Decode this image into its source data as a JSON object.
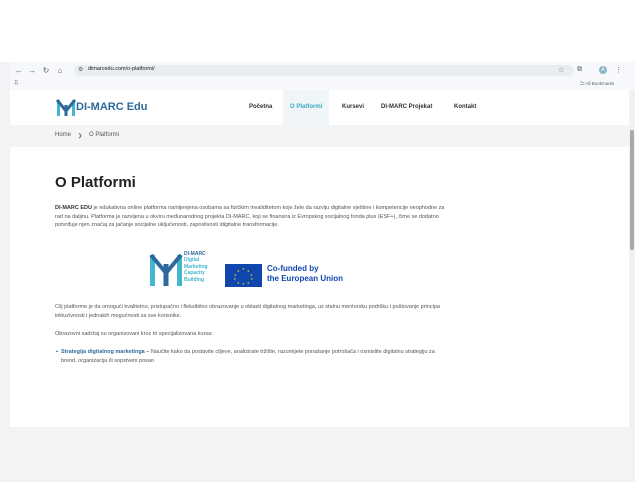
{
  "browser": {
    "url": "dimarcedu.com/o-platformi/",
    "bookmarks_label": "All Bookmarks",
    "avatar_letter": "A"
  },
  "site": {
    "logo_text": "DI-MARC Edu",
    "nav": [
      "Početna",
      "O Platformi",
      "Kursevi",
      "DI-MARC Projekat",
      "Kontakt"
    ],
    "breadcrumb": {
      "home": "Home",
      "separator": "❯",
      "current": "O Platformi"
    }
  },
  "content": {
    "title": "O Platformi",
    "intro_bold": "DI-MARC EDU",
    "intro_rest": " je edukativna online platforma namijenjena osobama sa fizičkim invaliditetom koje žele da razviju digitalne vještine i kompetencije neophodne za rad na daljinu. Platforma je razvijena u okviru međunarodnog projekta DI-MARC, koji se finansira iz Evropskog socijalnog fonda plus (ESF+), čime se dodatno potvrđuje njen značaj za jačanje socijalne uključenosti, zaposlivosti idigitalne transformacije.",
    "goal": "Cilj platforme je da omogući kvalitetno, pristupačno i fleksibilno obrazovanje u oblasti digitalnog marketinga, uz stalnu mentorsku podršku i poštovanje principa inkluzivnosti i jednakih mogućnosti za sve korisnike.",
    "courses_intro": "Obrazovni sadržaj su organizovani kroz tri specijalizovana kursa:",
    "bullet_bold": "Strategija digitalnog marketinga –",
    "bullet_rest": " Naučite kako da postavite ciljeve, analizirate tržište, razumijete ponašanje potrošača i osmislite digitalnu strategiju za brend, organizaciju ili sopstveni posao"
  },
  "logos": {
    "dimarc_lines": [
      "DI-MARC",
      "Digital",
      "Marketing",
      "Capacity",
      "Building"
    ],
    "eu_line1": "Co-funded by",
    "eu_line2": "the European Union"
  },
  "colors": {
    "brand": "#2d6a9b",
    "accent": "#3ba7c4",
    "eu_blue": "#0f47af",
    "eu_yellow": "#ffdd00"
  }
}
